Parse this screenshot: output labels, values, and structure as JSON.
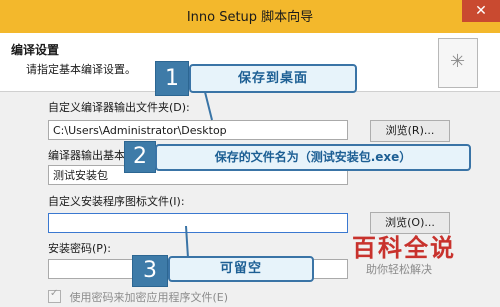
{
  "window": {
    "title": "Inno Setup 脚本向导",
    "close_symbol": "✕"
  },
  "header": {
    "title": "编译设置",
    "subtitle": "请指定基本编译设置。",
    "wizard_icon_symbol": "✳"
  },
  "fields": {
    "output_folder": {
      "label": "自定义编译器输出文件夹(D):",
      "value": "C:\\Users\\Administrator\\Desktop",
      "browse_label": "浏览(R)..."
    },
    "output_basename": {
      "label": "编译器输出基本文件名(E):",
      "value": "测试安装包"
    },
    "setup_icon": {
      "label": "自定义安装程序图标文件(I):",
      "value": "",
      "browse_label": "浏览(O)..."
    },
    "password": {
      "label": "安装密码(P):",
      "value": ""
    },
    "encrypt": {
      "label": "使用密码来加密应用程序文件(E)",
      "checked": true,
      "enabled": false
    }
  },
  "callouts": [
    {
      "number": "1",
      "text": "保存到桌面"
    },
    {
      "number": "2",
      "text": "保存的文件名为（测试安装包.exe）"
    },
    {
      "number": "3",
      "text": "可留空"
    }
  ],
  "watermark": {
    "main": "百科全说",
    "sub": "助你轻松解决"
  },
  "colors": {
    "title_bar": "#f3b82c",
    "close_button": "#c94a30",
    "callout_border": "#3a74a6",
    "callout_fill": "#e7f3fa",
    "callout_number_fill": "#3e7ba8",
    "watermark_red": "#c8322d"
  }
}
